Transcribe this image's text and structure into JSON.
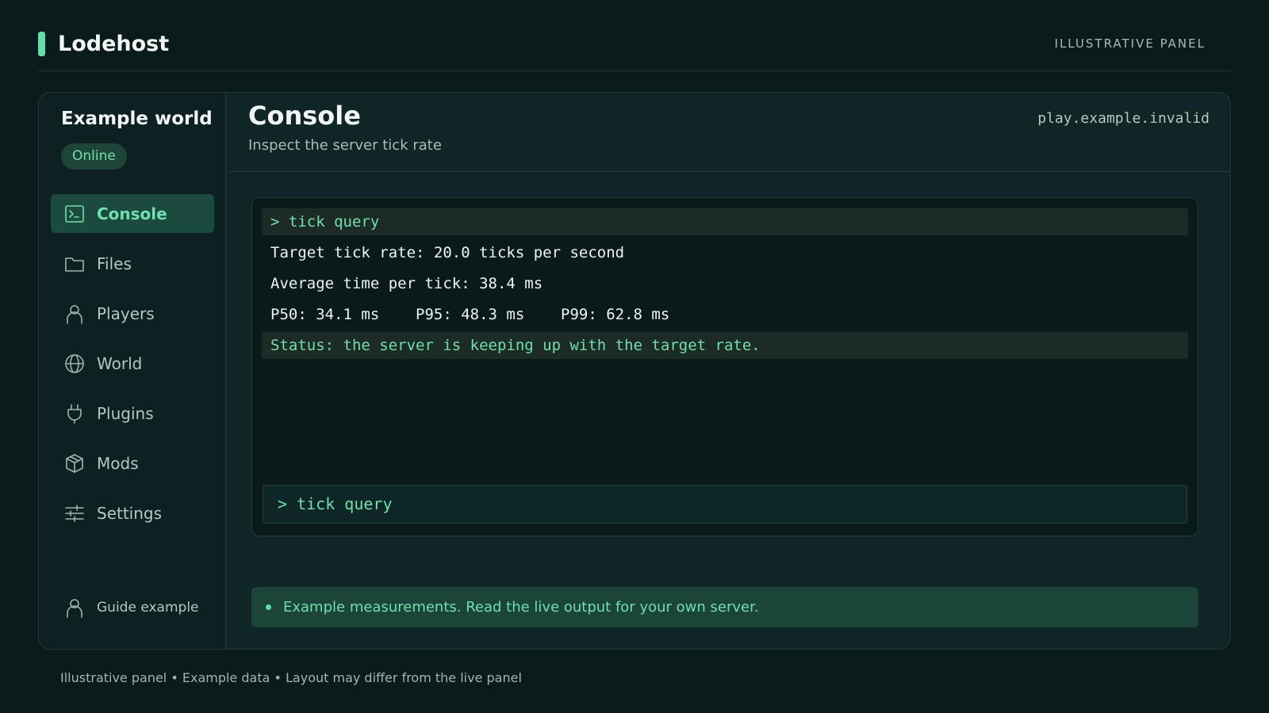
{
  "header": {
    "brand": "Lodehost",
    "tag": "ILLUSTRATIVE PANEL"
  },
  "sidebar": {
    "world_name": "Example world",
    "status": "Online",
    "items": [
      {
        "label": "Console",
        "icon": "terminal-icon",
        "active": true
      },
      {
        "label": "Files",
        "icon": "folder-icon"
      },
      {
        "label": "Players",
        "icon": "user-icon"
      },
      {
        "label": "World",
        "icon": "globe-icon"
      },
      {
        "label": "Plugins",
        "icon": "plug-icon"
      },
      {
        "label": "Mods",
        "icon": "box-icon"
      },
      {
        "label": "Settings",
        "icon": "sliders-icon"
      }
    ],
    "guide_label": "Guide example"
  },
  "main": {
    "title": "Console",
    "subtitle": "Inspect the server tick rate",
    "host": "play.example.invalid",
    "console": {
      "lines": [
        "> tick query",
        "Target tick rate: 20.0 ticks per second",
        "Average time per tick: 38.4 ms",
        "P50: 34.1 ms    P95: 48.3 ms    P99: 62.8 ms",
        "Status: the server is keeping up with the target rate."
      ],
      "input_value": "> tick query"
    },
    "notice": "Example measurements. Read the live output for your own server."
  },
  "footer": "Illustrative panel • Example data • Layout may differ from the live panel",
  "colors": {
    "accent": "#5ee0a8",
    "background": "#0b1b1c",
    "panel": "#0f2526"
  }
}
